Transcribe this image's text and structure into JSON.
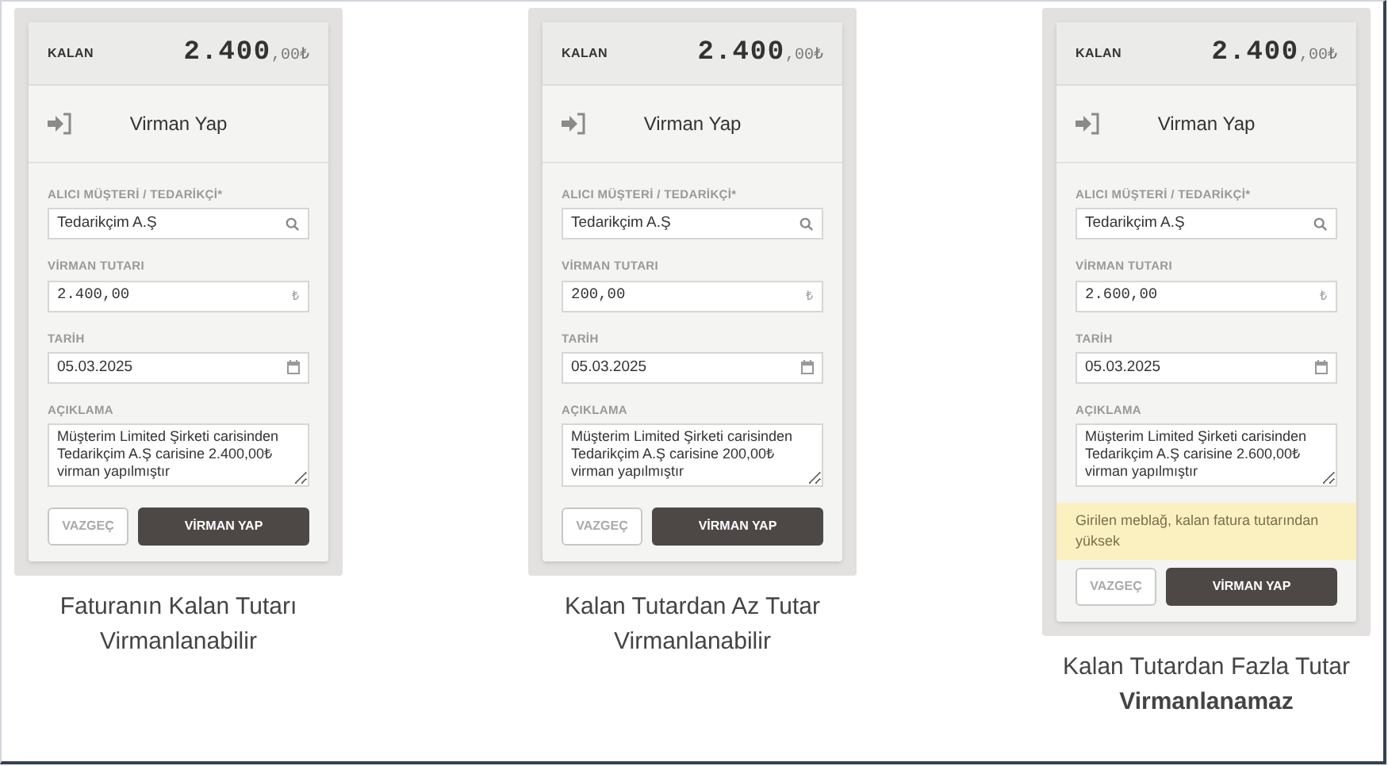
{
  "panels": [
    {
      "header": {
        "label": "KALAN",
        "amount": "2.400",
        "decimals": ",00₺"
      },
      "title": "Virman Yap",
      "fields": [
        {
          "kind": "search",
          "label": "ALICI MÜŞTERİ / TEDARİKÇİ*",
          "value": "Tedarikçim A.Ş"
        },
        {
          "kind": "amount",
          "label": "VİRMAN TUTARI",
          "value": "2.400,00",
          "suffix": "₺"
        },
        {
          "kind": "date",
          "label": "TARİH",
          "value": "05.03.2025"
        },
        {
          "kind": "textarea",
          "label": "AÇIKLAMA",
          "value": "Müşterim Limited Şirketi carisinden Tedarikçim A.Ş carisine 2.400,00₺ virman yapılmıştır"
        }
      ],
      "buttons": {
        "cancel": "VAZGEÇ",
        "submit": "VİRMAN YAP"
      },
      "caption": [
        {
          "text": "Faturanın Kalan Tutarı",
          "bold": false
        },
        {
          "text": "Virmanlanabilir",
          "bold": false
        }
      ]
    },
    {
      "header": {
        "label": "KALAN",
        "amount": "2.400",
        "decimals": ",00₺"
      },
      "title": "Virman Yap",
      "fields": [
        {
          "kind": "search",
          "label": "ALICI MÜŞTERİ / TEDARİKÇİ*",
          "value": "Tedarikçim A.Ş"
        },
        {
          "kind": "amount",
          "label": "VİRMAN TUTARI",
          "value": "200,00",
          "suffix": "₺"
        },
        {
          "kind": "date",
          "label": "TARİH",
          "value": "05.03.2025"
        },
        {
          "kind": "textarea",
          "label": "AÇIKLAMA",
          "value": "Müşterim Limited Şirketi carisinden Tedarikçim A.Ş carisine 200,00₺ virman yapılmıştır"
        }
      ],
      "buttons": {
        "cancel": "VAZGEÇ",
        "submit": "VİRMAN YAP"
      },
      "caption": [
        {
          "text": "Kalan Tutardan Az Tutar",
          "bold": false
        },
        {
          "text": "Virmanlanabilir",
          "bold": false
        }
      ]
    },
    {
      "header": {
        "label": "KALAN",
        "amount": "2.400",
        "decimals": ",00₺"
      },
      "title": "Virman Yap",
      "fields": [
        {
          "kind": "search",
          "label": "ALICI MÜŞTERİ / TEDARİKÇİ*",
          "value": "Tedarikçim A.Ş"
        },
        {
          "kind": "amount",
          "label": "VİRMAN TUTARI",
          "value": "2.600,00",
          "suffix": "₺"
        },
        {
          "kind": "date",
          "label": "TARİH",
          "value": "05.03.2025"
        },
        {
          "kind": "textarea",
          "label": "AÇIKLAMA",
          "value": "Müşterim Limited Şirketi carisinden Tedarikçim A.Ş carisine 2.600,00₺ virman yapılmıştır"
        }
      ],
      "warning": "Girilen meblağ, kalan fatura tutarından yüksek",
      "buttons": {
        "cancel": "VAZGEÇ",
        "submit": "VİRMAN YAP"
      },
      "caption": [
        {
          "text": "Kalan Tutardan Fazla Tutar",
          "bold": false
        },
        {
          "text": "Virmanlanamaz",
          "bold": true
        }
      ]
    }
  ]
}
